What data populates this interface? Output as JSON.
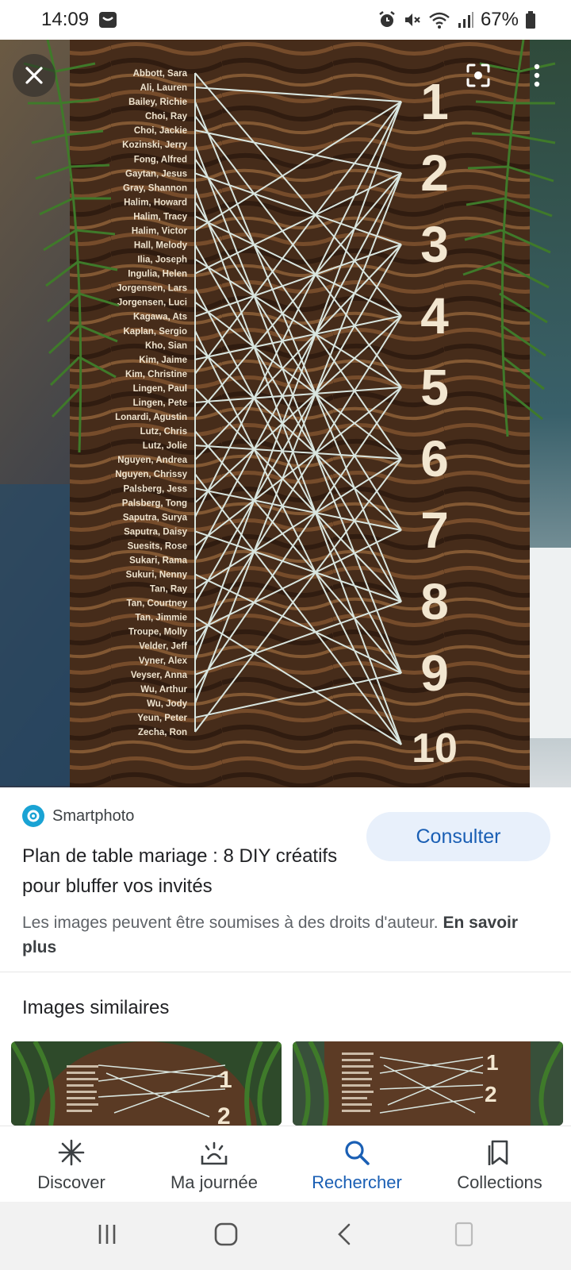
{
  "status_bar": {
    "time": "14:09",
    "battery": "67%",
    "icons": [
      "notification-icon",
      "alarm-icon",
      "mute-icon",
      "wifi-icon",
      "signal-icon",
      "battery-icon"
    ]
  },
  "hero": {
    "close_icon": "close-icon",
    "lens_icon": "lens-icon",
    "more_icon": "more-vert-icon",
    "board_names": [
      "Abbott, Sara",
      "Ali, Lauren",
      "Bailey, Richie",
      "Choi, Ray",
      "Choi, Jackie",
      "Kozinski, Jerry",
      "Fong, Alfred",
      "Gaytan, Jesus",
      "Gray, Shannon",
      "Halim, Howard",
      "Halim, Tracy",
      "Halim, Victor",
      "Hall, Melody",
      "Ilia, Joseph",
      "Ingulia, Helen",
      "Jorgensen, Lars",
      "Jorgensen, Luci",
      "Kagawa, Ats",
      "Kaplan, Sergio",
      "Kho, Sian",
      "Kim, Jaime",
      "Kim, Christine",
      "Lingen, Paul",
      "Lingen, Pete",
      "Lonardi, Agustin",
      "Lutz, Chris",
      "Lutz, Jolie",
      "Nguyen, Andrea",
      "Nguyen, Chrissy",
      "Palsberg, Jess",
      "Palsberg, Tong",
      "Saputra, Surya",
      "Saputra, Daisy",
      "Suesits, Rose",
      "Sukari, Rama",
      "Sukuri, Nenny",
      "Tan, Ray",
      "Tan, Courtney",
      "Tan, Jimmie",
      "Troupe, Molly",
      "Velder, Jeff",
      "Vyner, Alex",
      "Veyser, Anna",
      "Wu, Arthur",
      "Wu, Jody",
      "Yeun, Peter",
      "Zecha, Ron"
    ],
    "table_numbers": [
      "1",
      "2",
      "3",
      "4",
      "5",
      "6",
      "7",
      "8",
      "9",
      "10"
    ]
  },
  "result": {
    "source_name": "Smartphoto",
    "consult_label": "Consulter",
    "title": "Plan de table mariage : 8 DIY créatifs pour bluffer vos invités",
    "copyright_text": "Les images peuvent être soumises à des droits d'auteur.",
    "learn_more": "En savoir plus"
  },
  "similar": {
    "title": "Images similaires"
  },
  "bottom_nav": {
    "items": [
      {
        "label": "Discover",
        "icon": "discover-icon"
      },
      {
        "label": "Ma journée",
        "icon": "my-day-icon"
      },
      {
        "label": "Rechercher",
        "icon": "search-icon"
      },
      {
        "label": "Collections",
        "icon": "collections-icon"
      }
    ],
    "active_index": 2
  },
  "colors": {
    "accent": "#1a5fb4",
    "button_bg": "#e8f0fb",
    "wood_dark": "#3a2617",
    "wood_light": "#8a5a33",
    "string": "#d9e6e0",
    "fern": "#3f7a2a"
  }
}
